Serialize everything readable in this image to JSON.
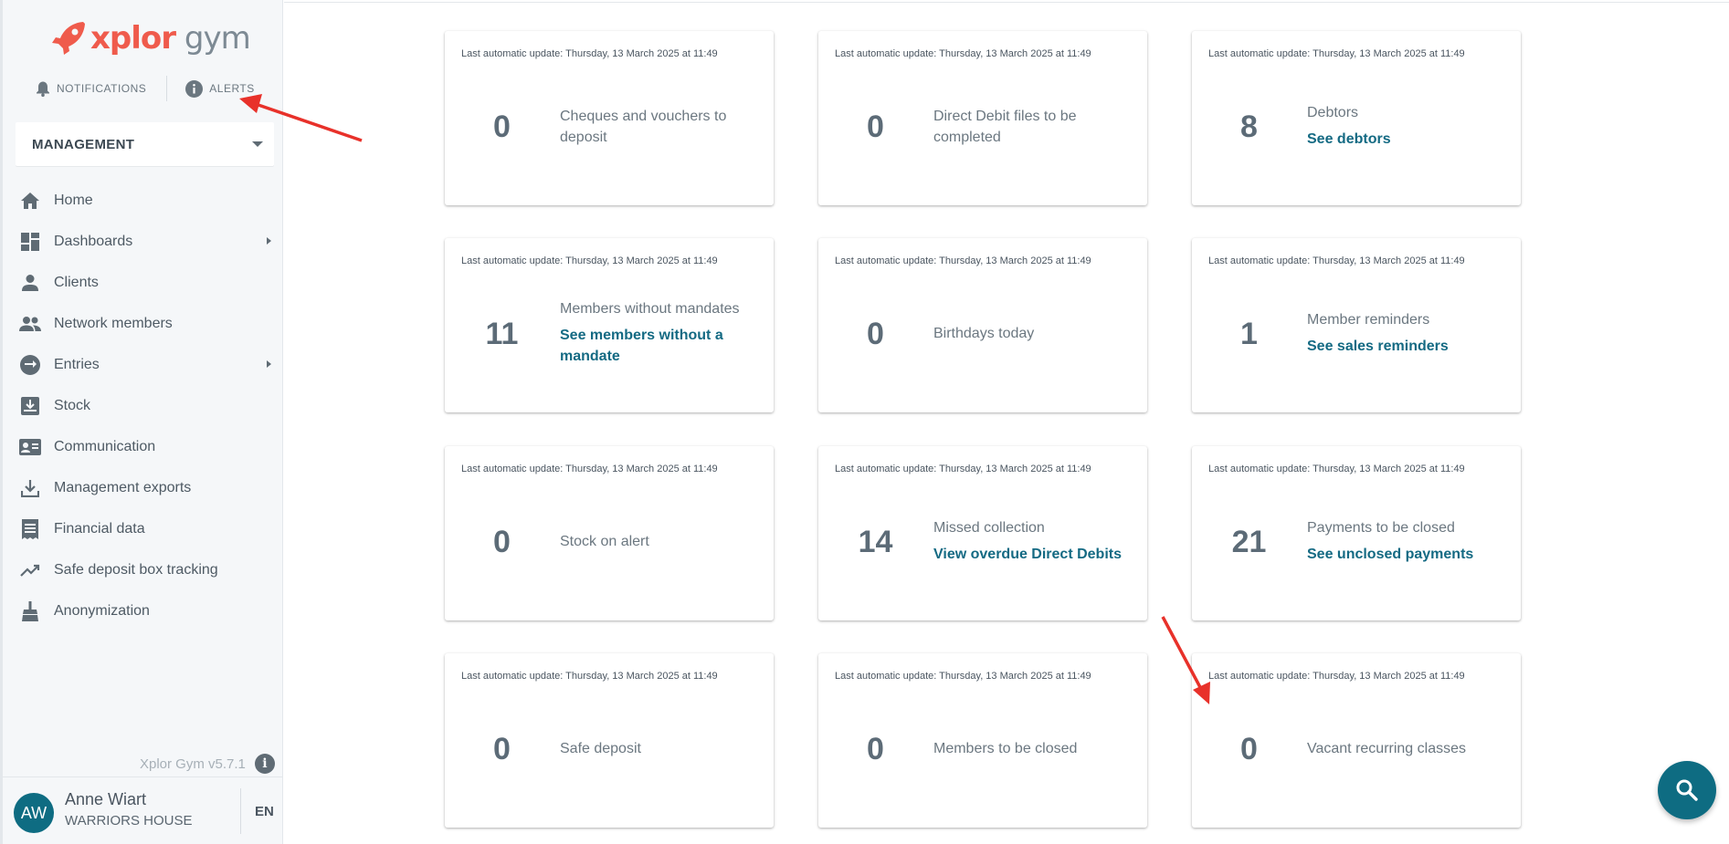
{
  "brand": {
    "logo_x": "xplor",
    "logo_gym": "gym",
    "accent": "#ef5b4c"
  },
  "sidebar": {
    "notifications_label": "NOTIFICATIONS",
    "alerts_label": "ALERTS",
    "context_select": "MANAGEMENT",
    "items": [
      {
        "label": "Home",
        "icon": "home-icon"
      },
      {
        "label": "Dashboards",
        "icon": "dashboard-icon",
        "has_submenu": true
      },
      {
        "label": "Clients",
        "icon": "person-icon"
      },
      {
        "label": "Network members",
        "icon": "group-icon"
      },
      {
        "label": "Entries",
        "icon": "swap-icon",
        "has_submenu": true
      },
      {
        "label": "Stock",
        "icon": "stock-icon"
      },
      {
        "label": "Communication",
        "icon": "contact-card-icon"
      },
      {
        "label": "Management exports",
        "icon": "download-icon"
      },
      {
        "label": "Financial data",
        "icon": "receipt-icon"
      },
      {
        "label": "Safe deposit box tracking",
        "icon": "trending-icon"
      },
      {
        "label": "Anonymization",
        "icon": "broom-icon"
      }
    ],
    "version": "Xplor Gym v5.7.1",
    "user": {
      "initials": "AW",
      "name": "Anne Wiart",
      "center": "WARRIORS HOUSE",
      "lang": "EN"
    }
  },
  "cards": [
    {
      "update": "Last automatic update: Thursday, 13 March 2025 at 11:49",
      "value": "0",
      "label": "Cheques and vouchers to deposit",
      "link": ""
    },
    {
      "update": "Last automatic update: Thursday, 13 March 2025 at 11:49",
      "value": "0",
      "label": "Direct Debit files to be completed",
      "link": ""
    },
    {
      "update": "Last automatic update: Thursday, 13 March 2025 at 11:49",
      "value": "8",
      "label": "Debtors",
      "link": "See debtors"
    },
    {
      "update": "Last automatic update: Thursday, 13 March 2025 at 11:49",
      "value": "11",
      "label": "Members without mandates",
      "link": "See members without a mandate"
    },
    {
      "update": "Last automatic update: Thursday, 13 March 2025 at 11:49",
      "value": "0",
      "label": "Birthdays today",
      "link": ""
    },
    {
      "update": "Last automatic update: Thursday, 13 March 2025 at 11:49",
      "value": "1",
      "label": "Member reminders",
      "link": "See sales reminders"
    },
    {
      "update": "Last automatic update: Thursday, 13 March 2025 at 11:49",
      "value": "0",
      "label": "Stock on alert",
      "link": ""
    },
    {
      "update": "Last automatic update: Thursday, 13 March 2025 at 11:49",
      "value": "14",
      "label": "Missed collection",
      "link": "View overdue Direct Debits"
    },
    {
      "update": "Last automatic update: Thursday, 13 March 2025 at 11:49",
      "value": "21",
      "label": "Payments to be closed",
      "link": "See unclosed payments"
    },
    {
      "update": "Last automatic update: Thursday, 13 March 2025 at 11:49",
      "value": "0",
      "label": "Safe deposit",
      "link": ""
    },
    {
      "update": "Last automatic update: Thursday, 13 March 2025 at 11:49",
      "value": "0",
      "label": "Members to be closed",
      "link": ""
    },
    {
      "update": "Last automatic update: Thursday, 13 March 2025 at 11:49",
      "value": "0",
      "label": "Vacant recurring classes",
      "link": ""
    }
  ],
  "fab": {
    "icon": "search-icon",
    "color": "#0e6c82"
  },
  "annotation_color": "#e8312a"
}
